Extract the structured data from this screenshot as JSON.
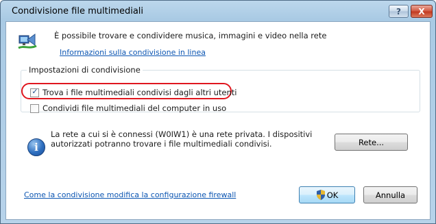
{
  "window": {
    "title": "Condivisione file multimediali",
    "help_label": "?",
    "close_label": "X"
  },
  "intro": {
    "text": "È possibile trovare e condividere musica, immagini e video nella rete",
    "link": "Informazioni sulla condivisione in linea"
  },
  "sharing_group": {
    "label": "Impostazioni di condivisione",
    "options": [
      {
        "label": "Trova i file multimediali condivisi dagli altri utenti",
        "checked": true
      },
      {
        "label": "Condividi file multimediali del computer in uso",
        "checked": false
      }
    ]
  },
  "network": {
    "message": "La rete a cui si è connessi (W0IW1) è una rete privata. I dispositivi autorizzati potranno trovare i file multimediali condivisi.",
    "button": "Rete..."
  },
  "footer": {
    "firewall_link": "Come la condivisione modifica la configurazione firewall",
    "ok": "OK",
    "cancel": "Annulla"
  },
  "colors": {
    "highlight": "#e0161e",
    "link": "#0b55b2"
  }
}
